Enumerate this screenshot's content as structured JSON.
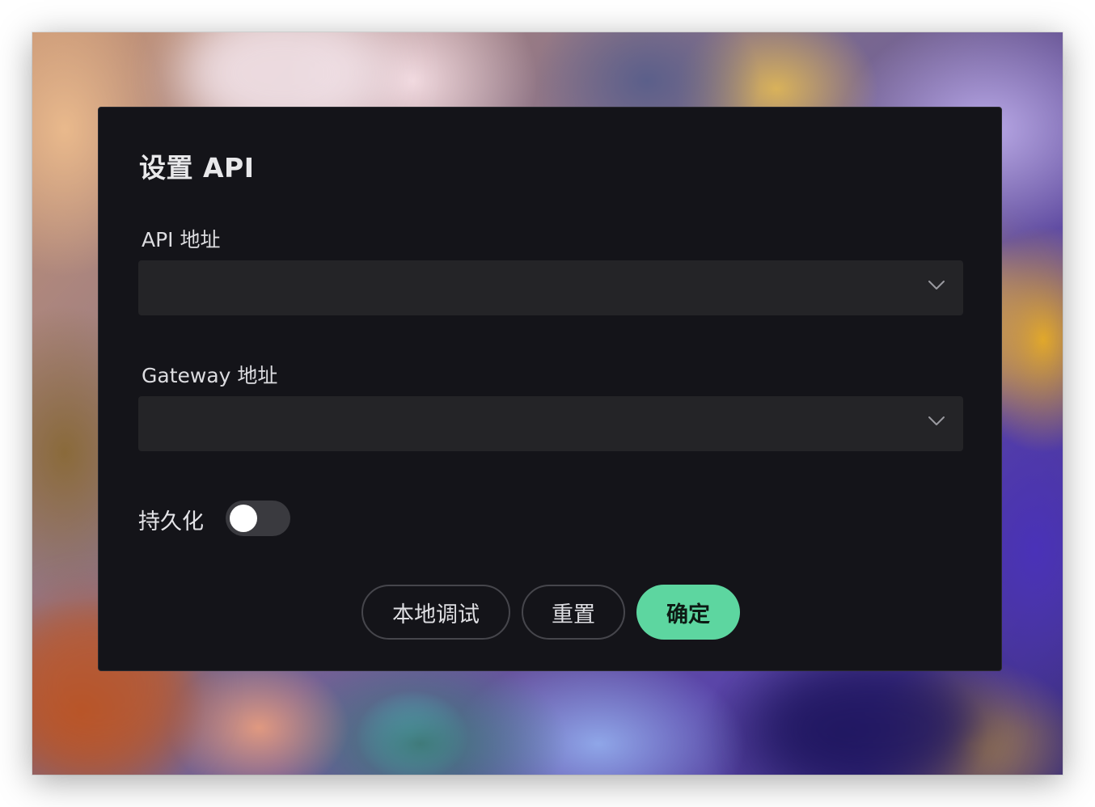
{
  "dialog": {
    "title": "设置 API",
    "api_field": {
      "label": "API 地址",
      "value": ""
    },
    "gateway_field": {
      "label": "Gateway 地址",
      "value": ""
    },
    "persist": {
      "label": "持久化",
      "enabled": false
    },
    "buttons": {
      "local_debug": "本地调试",
      "reset": "重置",
      "confirm": "确定"
    }
  },
  "colors": {
    "modal_bg": "#141419",
    "field_bg": "#242427",
    "primary": "#5dd6a0",
    "toggle_off": "#3a3a3f"
  },
  "icons": {
    "select_chevron": "chevron-down-icon"
  }
}
